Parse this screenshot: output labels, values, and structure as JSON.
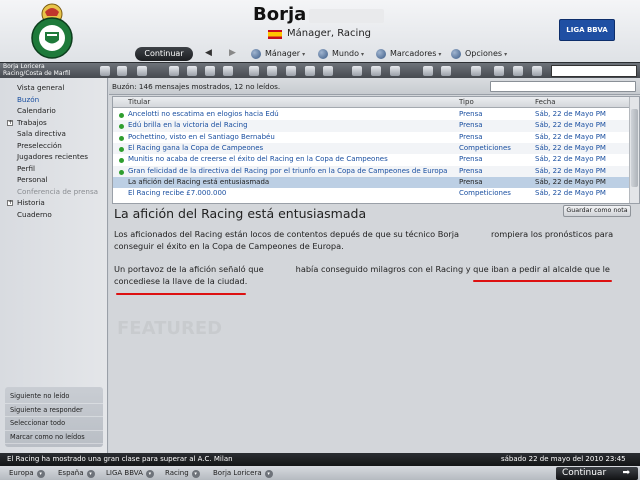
{
  "header": {
    "manager_name": "Borja",
    "role": "Mánager, Racing",
    "liga_logo_text": "LIGA BBVA"
  },
  "menu": {
    "continue_label": "Continuar",
    "back_arrow": "◀",
    "forward_arrow": "▶",
    "manager_label": "Mánager",
    "mundo_label": "Mundo",
    "marcadores_label": "Marcadores",
    "opciones_label": "Opciones",
    "caret": "▾"
  },
  "sidebar": {
    "club_line1": "Borja Loricera",
    "club_line2": "Racing/Costa de Marfil",
    "items": [
      {
        "label": "Vista general"
      },
      {
        "label": "Buzón"
      },
      {
        "label": "Calendario"
      },
      {
        "label": "Trabajos",
        "expander": "+"
      },
      {
        "label": "Sala directiva"
      },
      {
        "label": "Preselección"
      },
      {
        "label": "Jugadores recientes"
      },
      {
        "label": "Perfil"
      },
      {
        "label": "Personal"
      },
      {
        "label": "Conferencia de prensa"
      },
      {
        "label": "Historia",
        "expander": "+"
      },
      {
        "label": "Cuaderno"
      }
    ],
    "actions": [
      {
        "label": "Siguiente no leído"
      },
      {
        "label": "Siguiente a responder"
      },
      {
        "label": "Seleccionar todo"
      },
      {
        "label": "Marcar como no leídos"
      }
    ]
  },
  "inbox": {
    "count_text": "Buzón: 146 mensajes mostrados, 12 no leídos.",
    "columns": {
      "title": "Titular",
      "type": "Tipo",
      "date": "Fecha"
    },
    "rows": [
      {
        "title": "Ancelotti no escatima en elogios hacia Edú",
        "type": "Prensa",
        "date": "Sáb, 22 de Mayo PM"
      },
      {
        "title": "Edú brilla en la victoria del Racing",
        "type": "Prensa",
        "date": "Sáb, 22 de Mayo PM"
      },
      {
        "title": "Pochettino, visto en el Santiago Bernabéu",
        "type": "Prensa",
        "date": "Sáb, 22 de Mayo PM"
      },
      {
        "title": "El Racing gana la Copa de Campeones",
        "type": "Competiciones",
        "date": "Sáb, 22 de Mayo PM"
      },
      {
        "title": "Munitis no acaba de creerse el éxito del Racing en la Copa de Campeones",
        "type": "Prensa",
        "date": "Sáb, 22 de Mayo PM"
      },
      {
        "title": "Gran felicidad de la directiva del Racing por el triunfo en la Copa de Campeones de Europa",
        "type": "Prensa",
        "date": "Sáb, 22 de Mayo PM"
      },
      {
        "title": "La afición del Racing está entusiasmada",
        "type": "Prensa",
        "date": "Sáb, 22 de Mayo PM"
      },
      {
        "title": "El Racing recibe £7.000.000",
        "type": "Competiciones",
        "date": "Sáb, 22 de Mayo PM"
      }
    ]
  },
  "message": {
    "title": "La afición del Racing está entusiasmada",
    "save_label": "Guardar como nota",
    "para1_a": "Los aficionados del Racing están locos de contentos depués de que su técnico Borja",
    "para1_b": "rompiera los pronósticos para conseguir el éxito en la Copa de Campeones de Europa.",
    "para2_a": "Un portavoz de la afición señaló que",
    "para2_b": "había conseguido milagros con el Racing y que iban a pedir al alcalde que le concediese la llave de la ciudad.",
    "watermark": "FEATURED"
  },
  "status": {
    "news": "El Racing ha mostrado una gran clase para superar al A.C. Milan",
    "datetime": "sábado 22 de mayo del 2010 23:45"
  },
  "breadcrumbs": [
    {
      "label": "Europa"
    },
    {
      "label": "España"
    },
    {
      "label": "LIGA BBVA"
    },
    {
      "label": "Racing"
    },
    {
      "label": "Borja Loricera"
    }
  ],
  "bottom": {
    "continue_label": "Continuar",
    "continue_arrow": "➡"
  },
  "colors": {
    "accent_blue": "#1a4fa0",
    "unread_green": "#2f9e2f",
    "annotation_red": "#dd1111"
  }
}
